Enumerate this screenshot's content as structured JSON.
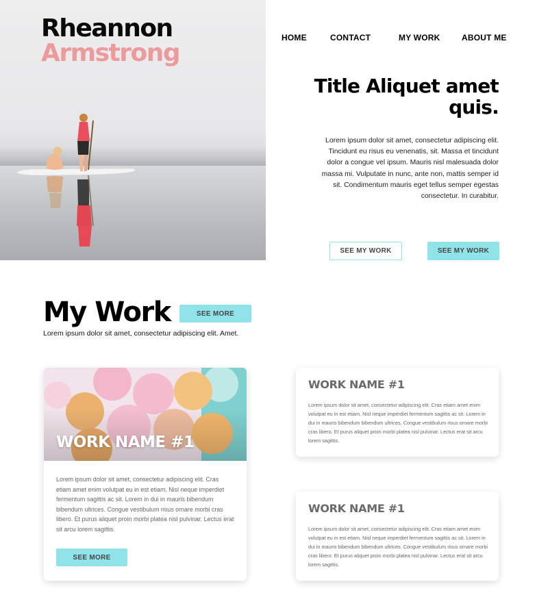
{
  "header": {
    "name_first": "Rheannon",
    "name_last": "Armstrong"
  },
  "nav": {
    "home": "HOME",
    "contact": "CONTACT",
    "my_work": "MY WORK",
    "about": "ABOUT ME"
  },
  "hero": {
    "title_line1": "Title Aliquet amet",
    "title_line2": "quis.",
    "body": "Lorem ipsum dolor sit amet, consectetur adipiscing elit. Tincidunt eu risus eu venenatis, sit. Massa et tincidunt dolor a congue vel ipsum. Mauris nisl malesuada dolor massa mi. Vulputate in nunc, ante non, mattis semper id sit. Condimentum mauris eget tellus semper egestas consectetur. In curabitur.",
    "button_outline": "SEE MY WORK",
    "button_filled": "SEE MY WORK"
  },
  "my_work": {
    "title": "My Work",
    "see_more": "SEE MORE",
    "subtitle": "Lorem ipsum dolor sit amet, consectetur adipiscing elit. Amet."
  },
  "cards": {
    "featured": {
      "title": "WORK NAME #1",
      "body": "Lorem ipsum dolor sit amet, consectetur adipiscing elit. Cras etiam amet enim volutpat eu in est etiam. Nisl neque imperdiet fermentum sagittis ac sit. Lorem in dui in mauris bibendum bibendum ultrices. Congue vestibulum risus ornare morbi cras libero. Et purus aliquet proin morbi platea nisl pulvinar. Lectus erat sit arcu lorem sagittis.",
      "button": "SEE MORE"
    },
    "right_top": {
      "title": "WORK NAME #1",
      "body": "Lorem ipsum dolor sit amet, consectetur adipiscing elit. Cras etiam amet enim volutpat eu in est etiam. Nisl neque imperdiet fermentum sagittis ac sit. Lorem in dui in mauris bibendum bibendum ultrices. Congue vestibulum risus ornare morbi cras libero. Et purus aliquet proin morbi platea nisl pulvinar. Lectus erat sit arcu lorem sagittis."
    },
    "right_bottom": {
      "title": "WORK NAME #1",
      "body": "Lorem ipsum dolor sit amet, consectetur adipiscing elit. Cras etiam amet enim volutpat eu in est etiam. Nisl neque imperdiet fermentum sagittis ac sit. Lorem in dui in mauris bibendum bibendum ultrices. Congue vestibulum risus ornare morbi cras libero. Et purus aliquet proin morbi platea nisl pulvinar. Lectus erat sit arcu lorem sagittis."
    }
  },
  "colors": {
    "accent": "#8fe3e9",
    "name_pink": "#ec9a9c",
    "text": "#000000",
    "muted": "#666666"
  }
}
